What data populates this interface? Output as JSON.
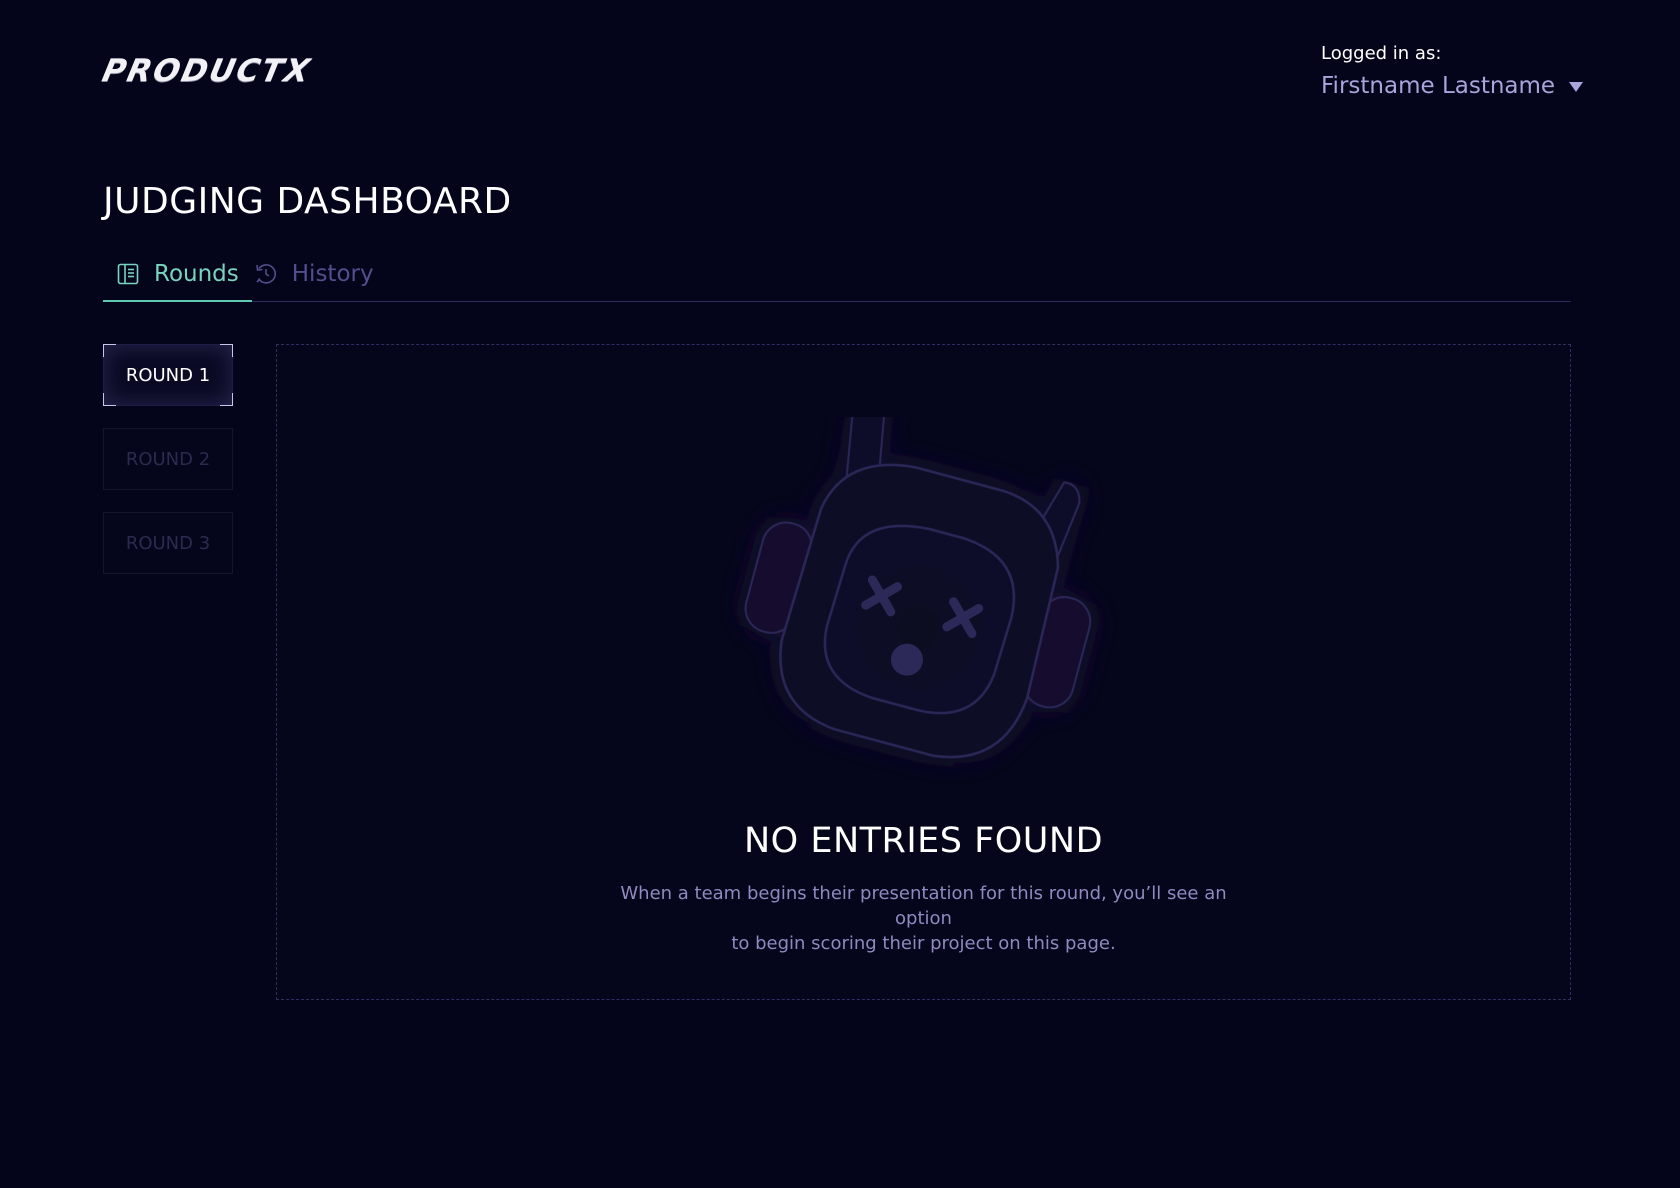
{
  "header": {
    "logo_text": "PRODUCTX",
    "logged_in_label": "Logged in as:",
    "user_name": "Firstname Lastname"
  },
  "page": {
    "title": "JUDGING DASHBOARD"
  },
  "tabs": [
    {
      "label": "Rounds",
      "icon": "book-icon",
      "active": true
    },
    {
      "label": "History",
      "icon": "clock-history-icon",
      "active": false
    }
  ],
  "rounds": [
    {
      "label": "ROUND 1",
      "active": true
    },
    {
      "label": "ROUND 2",
      "active": false
    },
    {
      "label": "ROUND 3",
      "active": false
    }
  ],
  "empty_state": {
    "illustration": "dead-robot-icon",
    "title": "NO ENTRIES FOUND",
    "description_line1": "When a team begins their presentation for this round, you’ll see an option",
    "description_line2": "to begin scoring their project on this page."
  },
  "colors": {
    "background": "#04041a",
    "accent": "#5ec9ae",
    "muted_purple": "#534e8c",
    "user_name": "#a9a4dc"
  }
}
